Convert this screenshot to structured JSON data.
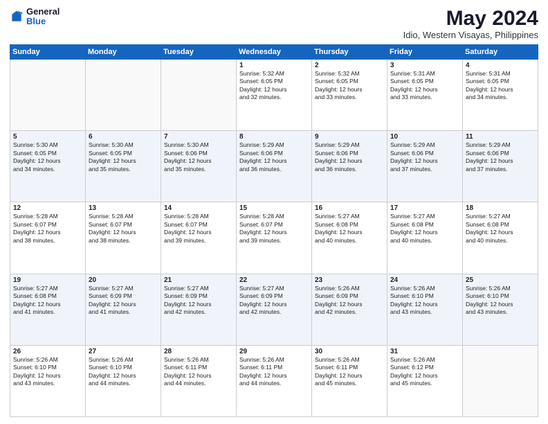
{
  "header": {
    "logo_general": "General",
    "logo_blue": "Blue",
    "month_title": "May 2024",
    "location": "Idio, Western Visayas, Philippines"
  },
  "weekdays": [
    "Sunday",
    "Monday",
    "Tuesday",
    "Wednesday",
    "Thursday",
    "Friday",
    "Saturday"
  ],
  "weeks": [
    [
      {
        "day": "",
        "content": ""
      },
      {
        "day": "",
        "content": ""
      },
      {
        "day": "",
        "content": ""
      },
      {
        "day": "1",
        "content": "Sunrise: 5:32 AM\nSunset: 6:05 PM\nDaylight: 12 hours\nand 32 minutes."
      },
      {
        "day": "2",
        "content": "Sunrise: 5:32 AM\nSunset: 6:05 PM\nDaylight: 12 hours\nand 33 minutes."
      },
      {
        "day": "3",
        "content": "Sunrise: 5:31 AM\nSunset: 6:05 PM\nDaylight: 12 hours\nand 33 minutes."
      },
      {
        "day": "4",
        "content": "Sunrise: 5:31 AM\nSunset: 6:05 PM\nDaylight: 12 hours\nand 34 minutes."
      }
    ],
    [
      {
        "day": "5",
        "content": "Sunrise: 5:30 AM\nSunset: 6:05 PM\nDaylight: 12 hours\nand 34 minutes."
      },
      {
        "day": "6",
        "content": "Sunrise: 5:30 AM\nSunset: 6:05 PM\nDaylight: 12 hours\nand 35 minutes."
      },
      {
        "day": "7",
        "content": "Sunrise: 5:30 AM\nSunset: 6:06 PM\nDaylight: 12 hours\nand 35 minutes."
      },
      {
        "day": "8",
        "content": "Sunrise: 5:29 AM\nSunset: 6:06 PM\nDaylight: 12 hours\nand 36 minutes."
      },
      {
        "day": "9",
        "content": "Sunrise: 5:29 AM\nSunset: 6:06 PM\nDaylight: 12 hours\nand 36 minutes."
      },
      {
        "day": "10",
        "content": "Sunrise: 5:29 AM\nSunset: 6:06 PM\nDaylight: 12 hours\nand 37 minutes."
      },
      {
        "day": "11",
        "content": "Sunrise: 5:29 AM\nSunset: 6:06 PM\nDaylight: 12 hours\nand 37 minutes."
      }
    ],
    [
      {
        "day": "12",
        "content": "Sunrise: 5:28 AM\nSunset: 6:07 PM\nDaylight: 12 hours\nand 38 minutes."
      },
      {
        "day": "13",
        "content": "Sunrise: 5:28 AM\nSunset: 6:07 PM\nDaylight: 12 hours\nand 38 minutes."
      },
      {
        "day": "14",
        "content": "Sunrise: 5:28 AM\nSunset: 6:07 PM\nDaylight: 12 hours\nand 39 minutes."
      },
      {
        "day": "15",
        "content": "Sunrise: 5:28 AM\nSunset: 6:07 PM\nDaylight: 12 hours\nand 39 minutes."
      },
      {
        "day": "16",
        "content": "Sunrise: 5:27 AM\nSunset: 6:08 PM\nDaylight: 12 hours\nand 40 minutes."
      },
      {
        "day": "17",
        "content": "Sunrise: 5:27 AM\nSunset: 6:08 PM\nDaylight: 12 hours\nand 40 minutes."
      },
      {
        "day": "18",
        "content": "Sunrise: 5:27 AM\nSunset: 6:08 PM\nDaylight: 12 hours\nand 40 minutes."
      }
    ],
    [
      {
        "day": "19",
        "content": "Sunrise: 5:27 AM\nSunset: 6:08 PM\nDaylight: 12 hours\nand 41 minutes."
      },
      {
        "day": "20",
        "content": "Sunrise: 5:27 AM\nSunset: 6:09 PM\nDaylight: 12 hours\nand 41 minutes."
      },
      {
        "day": "21",
        "content": "Sunrise: 5:27 AM\nSunset: 6:09 PM\nDaylight: 12 hours\nand 42 minutes."
      },
      {
        "day": "22",
        "content": "Sunrise: 5:27 AM\nSunset: 6:09 PM\nDaylight: 12 hours\nand 42 minutes."
      },
      {
        "day": "23",
        "content": "Sunrise: 5:26 AM\nSunset: 6:09 PM\nDaylight: 12 hours\nand 42 minutes."
      },
      {
        "day": "24",
        "content": "Sunrise: 5:26 AM\nSunset: 6:10 PM\nDaylight: 12 hours\nand 43 minutes."
      },
      {
        "day": "25",
        "content": "Sunrise: 5:26 AM\nSunset: 6:10 PM\nDaylight: 12 hours\nand 43 minutes."
      }
    ],
    [
      {
        "day": "26",
        "content": "Sunrise: 5:26 AM\nSunset: 6:10 PM\nDaylight: 12 hours\nand 43 minutes."
      },
      {
        "day": "27",
        "content": "Sunrise: 5:26 AM\nSunset: 6:10 PM\nDaylight: 12 hours\nand 44 minutes."
      },
      {
        "day": "28",
        "content": "Sunrise: 5:26 AM\nSunset: 6:11 PM\nDaylight: 12 hours\nand 44 minutes."
      },
      {
        "day": "29",
        "content": "Sunrise: 5:26 AM\nSunset: 6:11 PM\nDaylight: 12 hours\nand 44 minutes."
      },
      {
        "day": "30",
        "content": "Sunrise: 5:26 AM\nSunset: 6:11 PM\nDaylight: 12 hours\nand 45 minutes."
      },
      {
        "day": "31",
        "content": "Sunrise: 5:26 AM\nSunset: 6:12 PM\nDaylight: 12 hours\nand 45 minutes."
      },
      {
        "day": "",
        "content": ""
      }
    ]
  ]
}
